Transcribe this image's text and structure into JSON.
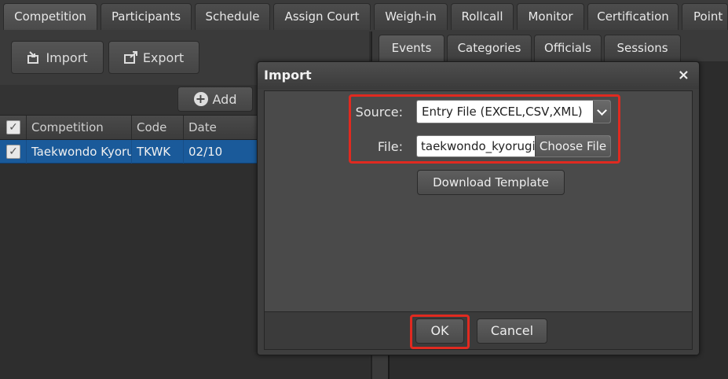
{
  "top_tabs": [
    {
      "label": "Competition",
      "active": true
    },
    {
      "label": "Participants"
    },
    {
      "label": "Schedule"
    },
    {
      "label": "Assign Court"
    },
    {
      "label": "Weigh-in"
    },
    {
      "label": "Rollcall"
    },
    {
      "label": "Monitor"
    },
    {
      "label": "Certification"
    },
    {
      "label": "Point"
    }
  ],
  "left_panel": {
    "import_label": "Import",
    "export_label": "Export",
    "add_label": "Add",
    "columns": [
      "Competition",
      "Code",
      "Date"
    ],
    "rows": [
      {
        "checked": true,
        "competition": "Taekwondo Kyorugi",
        "code": "TKWK",
        "date": "02/10"
      }
    ]
  },
  "right_tabs": [
    {
      "label": "Events",
      "active": true
    },
    {
      "label": "Categories"
    },
    {
      "label": "Officials"
    },
    {
      "label": "Sessions"
    }
  ],
  "modal": {
    "title": "Import",
    "close_glyph": "×",
    "source_label": "Source:",
    "source_value": "Entry File (EXCEL,CSV,XML)",
    "file_label": "File:",
    "file_value": "taekwondo_kyorugi.xlsx",
    "choose_file_label": "Choose File",
    "download_template_label": "Download Template",
    "ok_label": "OK",
    "cancel_label": "Cancel"
  },
  "colors": {
    "highlight_red": "#e02a20",
    "selected_row": "#1a5a9a"
  }
}
